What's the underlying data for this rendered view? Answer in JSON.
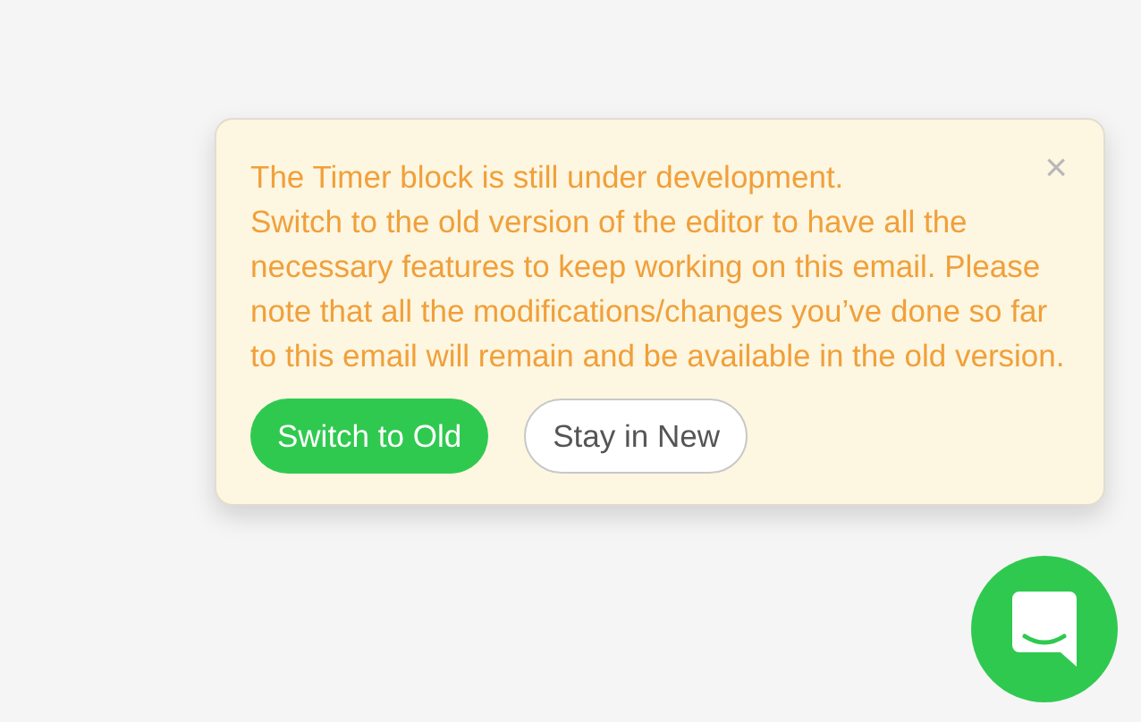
{
  "notice": {
    "title": "The Timer block is still under development.",
    "body_lines": [
      "Switch to the old version of the editor to have all the",
      "necessary features to keep working on this email. Please",
      "note that all the modifications/changes you’ve done so far",
      "to this email will remain and be available in the old version."
    ],
    "close": "×",
    "buttons": [
      {
        "label": "Switch to Old",
        "kind": "primary"
      },
      {
        "label": "Stay in New",
        "kind": "secondary"
      }
    ]
  }
}
